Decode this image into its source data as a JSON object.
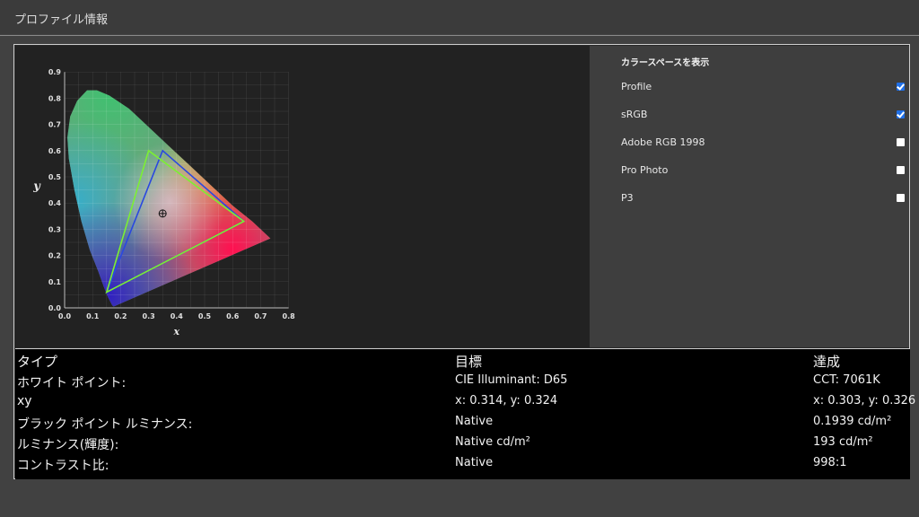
{
  "window": {
    "title": "プロファイル情報"
  },
  "chart": {
    "y_axis_label": "y",
    "x_axis_label": "x",
    "y_ticks": [
      "0.9",
      "0.8",
      "0.7",
      "0.6",
      "0.5",
      "0.4",
      "0.3",
      "0.2",
      "0.1",
      "0.0"
    ],
    "x_ticks": [
      "0.0",
      "0.1",
      "0.2",
      "0.3",
      "0.4",
      "0.5",
      "0.6",
      "0.7",
      "0.8"
    ],
    "triangles": [
      {
        "name": "Profile",
        "color": "#2a48e0",
        "points": [
          [
            0.64,
            0.33
          ],
          [
            0.35,
            0.6
          ],
          [
            0.15,
            0.06
          ]
        ]
      },
      {
        "name": "sRGB",
        "color": "#7cf032",
        "points": [
          [
            0.64,
            0.33
          ],
          [
            0.3,
            0.6
          ],
          [
            0.15,
            0.06
          ]
        ]
      }
    ],
    "white_point": [
      0.35,
      0.36
    ]
  },
  "colorspaces": {
    "title": "カラースペースを表示",
    "items": [
      {
        "label": "Profile",
        "checked": true
      },
      {
        "label": "sRGB",
        "checked": true
      },
      {
        "label": "Adobe RGB 1998",
        "checked": false
      },
      {
        "label": "Pro Photo",
        "checked": false
      },
      {
        "label": "P3",
        "checked": false
      }
    ]
  },
  "table": {
    "headers": [
      "タイプ",
      "目標",
      "達成"
    ],
    "rows": [
      [
        "ホワイト ポイント:",
        "CIE Illuminant: D65",
        "CCT: 7061K"
      ],
      [
        "xy",
        "x: 0.314, y: 0.324",
        "x: 0.303, y: 0.326"
      ],
      [
        "ブラック ポイント ルミナンス:",
        "Native",
        "0.1939 cd/m²"
      ],
      [
        "ルミナンス(輝度):",
        "Native cd/m²",
        "193 cd/m²"
      ],
      [
        "コントラスト比:",
        "Native",
        "998:1"
      ]
    ]
  }
}
